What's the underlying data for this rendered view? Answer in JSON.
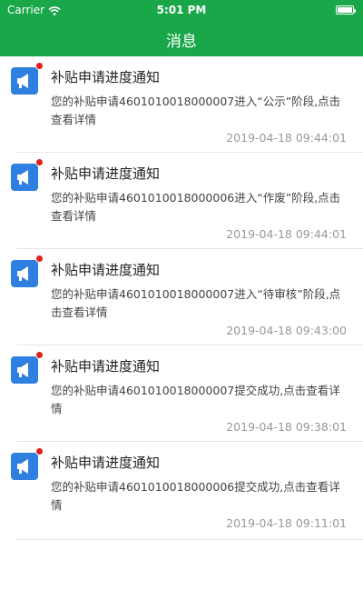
{
  "status_bar": {
    "carrier": "Carrier",
    "time": "5:01 PM"
  },
  "header": {
    "title": "消息"
  },
  "messages": [
    {
      "title": "补贴申请进度通知",
      "body": "您的补贴申请4601010018000007进入“公示”阶段,点击查看详情",
      "time": "2019-04-18 09:44:01"
    },
    {
      "title": "补贴申请进度通知",
      "body": "您的补贴申请4601010018000006进入“作废”阶段,点击查看详情",
      "time": "2019-04-18 09:44:01"
    },
    {
      "title": "补贴申请进度通知",
      "body": "您的补贴申请4601010018000007进入“待审核”阶段,点击查看详情",
      "time": "2019-04-18 09:43:00"
    },
    {
      "title": "补贴申请进度通知",
      "body": "您的补贴申请4601010018000007提交成功,点击查看详情",
      "time": "2019-04-18 09:38:01"
    },
    {
      "title": "补贴申请进度通知",
      "body": "您的补贴申请4601010018000006提交成功,点击查看详情",
      "time": "2019-04-18 09:11:01"
    }
  ],
  "icons": {
    "status": [
      "wifi-icon",
      "battery-icon"
    ],
    "message": "megaphone-icon",
    "unread": "unread-dot"
  },
  "colors": {
    "header": "#1aa74a",
    "icon_bg": "#2f7fe0",
    "unread_dot": "#e0201b"
  }
}
